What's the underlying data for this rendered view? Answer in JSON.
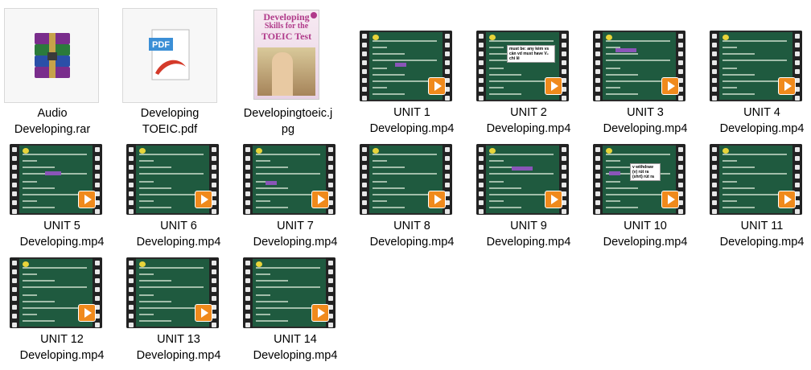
{
  "files": [
    {
      "line1": "Audio",
      "line2": "Developing.rar",
      "type": "rar",
      "icon": "winrar-icon"
    },
    {
      "line1": "Developing",
      "line2": "TOEIC.pdf",
      "type": "pdf",
      "icon": "pdf-icon"
    },
    {
      "line1": "Developingtoeic.j",
      "line2": "pg",
      "type": "jpg",
      "icon": "book-cover-image"
    },
    {
      "line1": "UNIT 1",
      "line2": "Developing.mp4",
      "type": "mp4",
      "icon": "video-thumbnail"
    },
    {
      "line1": "UNIT 2",
      "line2": "Developing.mp4",
      "type": "mp4",
      "icon": "video-thumbnail",
      "popup": "must be: any kèm vs cần vd must have V₂ chỉ lẽ"
    },
    {
      "line1": "UNIT 3",
      "line2": "Developing.mp4",
      "type": "mp4",
      "icon": "video-thumbnail"
    },
    {
      "line1": "UNIT 4",
      "line2": "Developing.mp4",
      "type": "mp4",
      "icon": "video-thumbnail"
    },
    {
      "line1": "UNIT 5",
      "line2": "Developing.mp4",
      "type": "mp4",
      "icon": "video-thumbnail"
    },
    {
      "line1": "UNIT 6",
      "line2": "Developing.mp4",
      "type": "mp4",
      "icon": "video-thumbnail"
    },
    {
      "line1": "UNIT 7",
      "line2": "Developing.mp4",
      "type": "mp4",
      "icon": "video-thumbnail"
    },
    {
      "line1": "UNIT 8",
      "line2": "Developing.mp4",
      "type": "mp4",
      "icon": "video-thumbnail"
    },
    {
      "line1": "UNIT 9",
      "line2": "Developing.mp4",
      "type": "mp4",
      "icon": "video-thumbnail"
    },
    {
      "line1": "UNIT 10",
      "line2": "Developing.mp4",
      "type": "mp4",
      "icon": "video-thumbnail",
      "popup": "v withdraw (v) rút ra (shrt) rút ra"
    },
    {
      "line1": "UNIT 11",
      "line2": "Developing.mp4",
      "type": "mp4",
      "icon": "video-thumbnail"
    },
    {
      "line1": "UNIT 12",
      "line2": "Developing.mp4",
      "type": "mp4",
      "icon": "video-thumbnail"
    },
    {
      "line1": "UNIT 13",
      "line2": "Developing.mp4",
      "type": "mp4",
      "icon": "video-thumbnail"
    },
    {
      "line1": "UNIT 14",
      "line2": "Developing.mp4",
      "type": "mp4",
      "icon": "video-thumbnail"
    }
  ],
  "book_cover": {
    "title1": "Developing",
    "title2": "Skills for the",
    "title3": "TOEIC Test"
  },
  "colors": {
    "board_green": "#1f5a3f",
    "play_orange": "#f08a1c",
    "cover_purple": "#b03a8a",
    "highlight_purple": "#8a55b8"
  }
}
